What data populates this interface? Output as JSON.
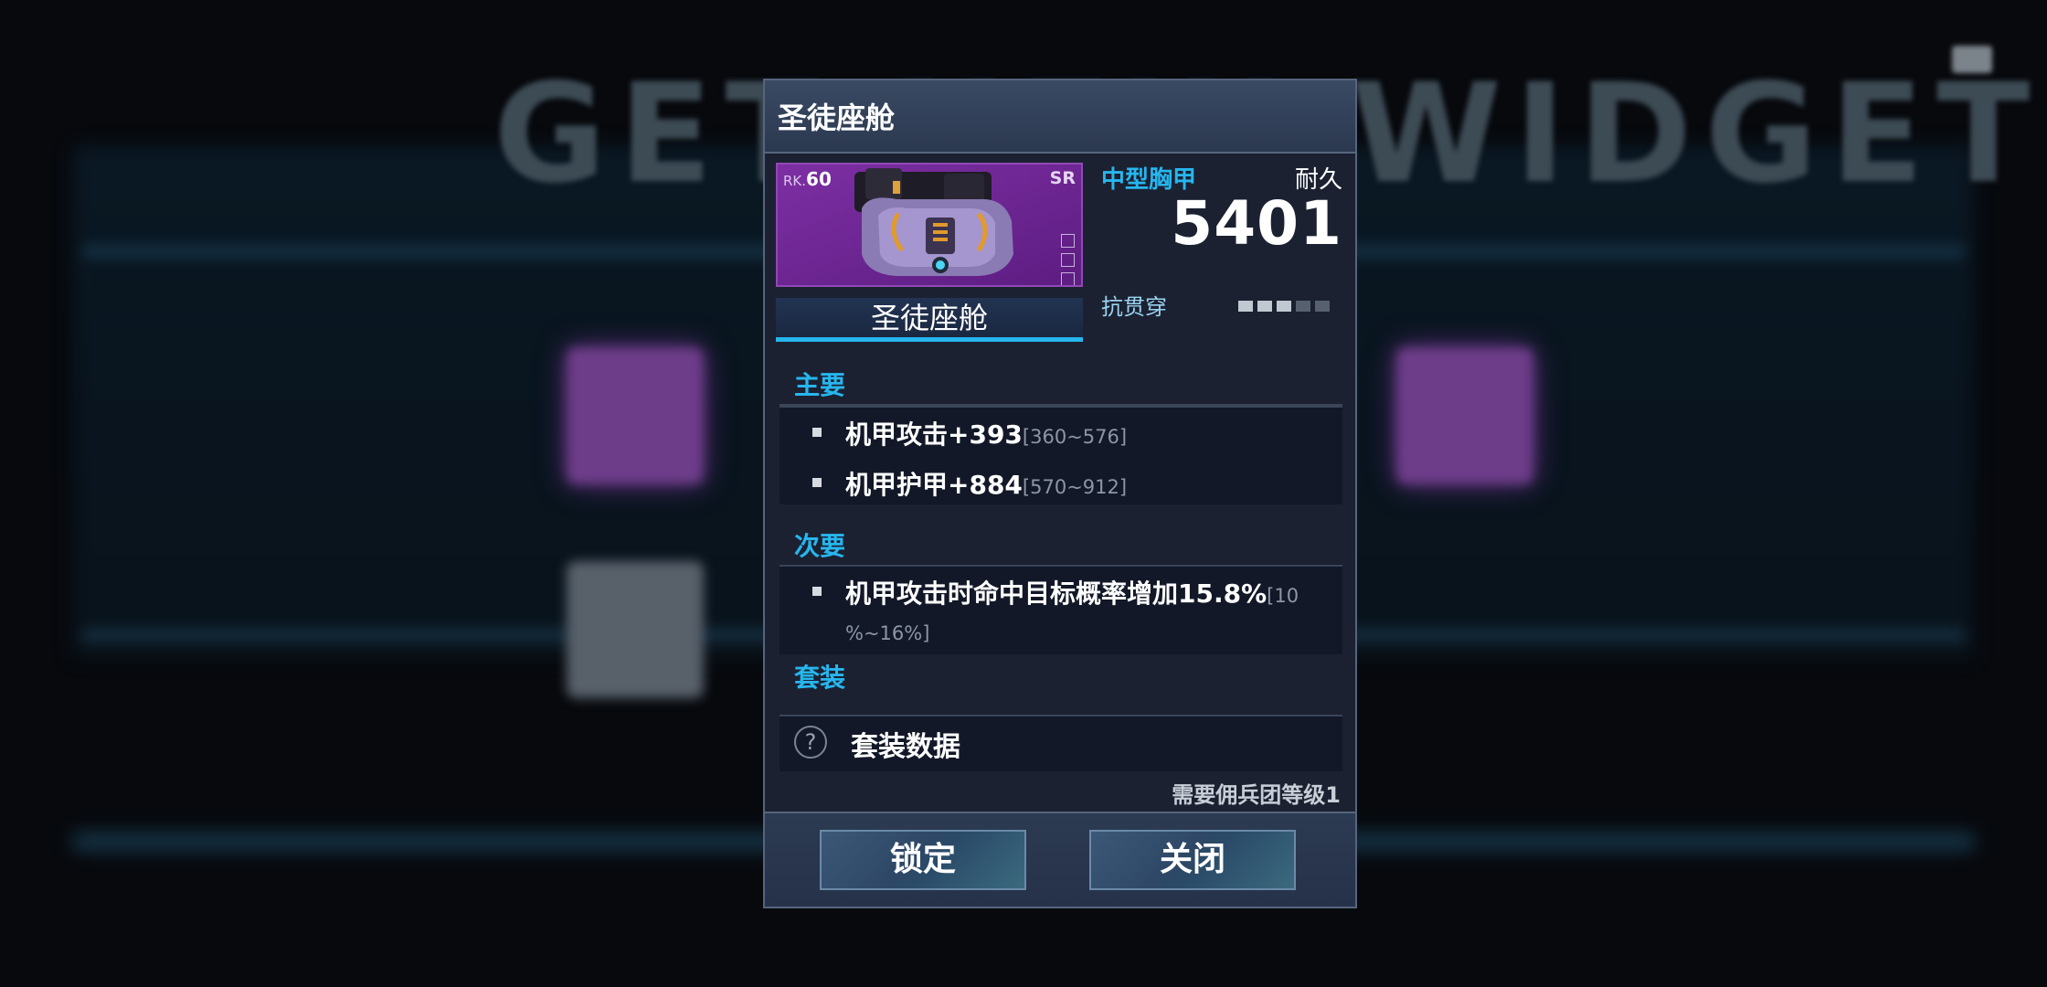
{
  "background": {
    "title": "GET NEW WIDGETS"
  },
  "dialog": {
    "title": "圣徒座舱",
    "item": {
      "rank_prefix": "RK.",
      "rank": "60",
      "rarity": "SR",
      "name": "圣徒座舱",
      "type": "中型胸甲",
      "durability_label": "耐久",
      "durability": "5401",
      "penetration_label": "抗贯穿",
      "penetration_level": 3,
      "penetration_max": 5,
      "art_icon": "mech-chest-armor-icon"
    },
    "primary": {
      "title": "主要",
      "stats": [
        {
          "text": "机甲攻击+393",
          "range": "[360~576]"
        },
        {
          "text": "机甲护甲+884",
          "range": "[570~912]"
        }
      ]
    },
    "secondary": {
      "title": "次要",
      "stats": [
        {
          "text": "机甲攻击时命中目标概率增加15.8%",
          "range_line1": "[10",
          "range_line2": "%~16%]"
        }
      ]
    },
    "set": {
      "title": "套装",
      "label": "套装数据",
      "help_icon": "question-icon",
      "help_glyph": "?"
    },
    "requirement": "需要佣兵团等级1",
    "buttons": {
      "lock": "锁定",
      "close": "关闭"
    }
  },
  "colors": {
    "accent": "#27b6ee",
    "rarity_purple": "#6e2a93",
    "panel": "#1b2131"
  }
}
